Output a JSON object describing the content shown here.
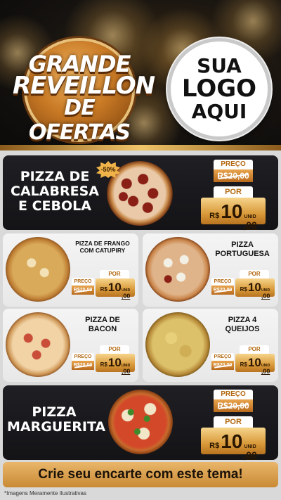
{
  "header": {
    "badge": {
      "line1": "GRANDE",
      "line2": "REVEILLON",
      "line3": "DE OFERTAS"
    },
    "logo": {
      "line1": "SUA",
      "line2": "LOGO",
      "line3": "AQUI"
    }
  },
  "products": {
    "calabresa": {
      "name_line1": "PIZZA DE",
      "name_line2": "CALABRESA",
      "name_line3": "E CEBOLA",
      "discount": "-50%",
      "preco_label": "PREÇO",
      "old_price": "R$20,00",
      "por_label": "POR",
      "currency": "R$",
      "price_int": "10",
      "price_dec": ",00",
      "unid": "UNID"
    },
    "frango": {
      "name_line1": "PIZZA DE FRANGO",
      "name_line2": "COM CATUPIRY",
      "preco_label": "PREÇO",
      "old_price": "R$20,00",
      "por_label": "POR",
      "currency": "R$",
      "price_int": "10",
      "price_dec": ",00",
      "unid": "UNID"
    },
    "portuguesa": {
      "name_line1": "PIZZA",
      "name_line2": "PORTUGUESA",
      "preco_label": "PREÇO",
      "old_price": "R$20,00",
      "por_label": "POR",
      "currency": "R$",
      "price_int": "10",
      "price_dec": ",00",
      "unid": "UNID"
    },
    "bacon": {
      "name_line1": "PIZZA DE",
      "name_line2": "BACON",
      "preco_label": "PREÇO",
      "old_price": "R$20,00",
      "por_label": "POR",
      "currency": "R$",
      "price_int": "10",
      "price_dec": ",00",
      "unid": "UNID"
    },
    "queijos": {
      "name_line1": "PIZZA 4",
      "name_line2": "QUEIJOS",
      "preco_label": "PREÇO",
      "old_price": "R$20,00",
      "por_label": "POR",
      "currency": "R$",
      "price_int": "10",
      "price_dec": ",00",
      "unid": "UNID"
    },
    "marguerita": {
      "name_line1": "PIZZA",
      "name_line2": "MARGUERITA",
      "preco_label": "PREÇO",
      "old_price": "R$20,00",
      "por_label": "POR",
      "currency": "R$",
      "price_int": "10",
      "price_dec": ",00",
      "unid": "UNID"
    }
  },
  "footer": {
    "cta": "Crie seu encarte com este tema!",
    "disclaimer": "*Imagens Meramente Ilustrativas"
  },
  "colors": {
    "gold": "#d99a3a",
    "dark_card": "#1a1a1e",
    "light_card": "#efefef"
  }
}
